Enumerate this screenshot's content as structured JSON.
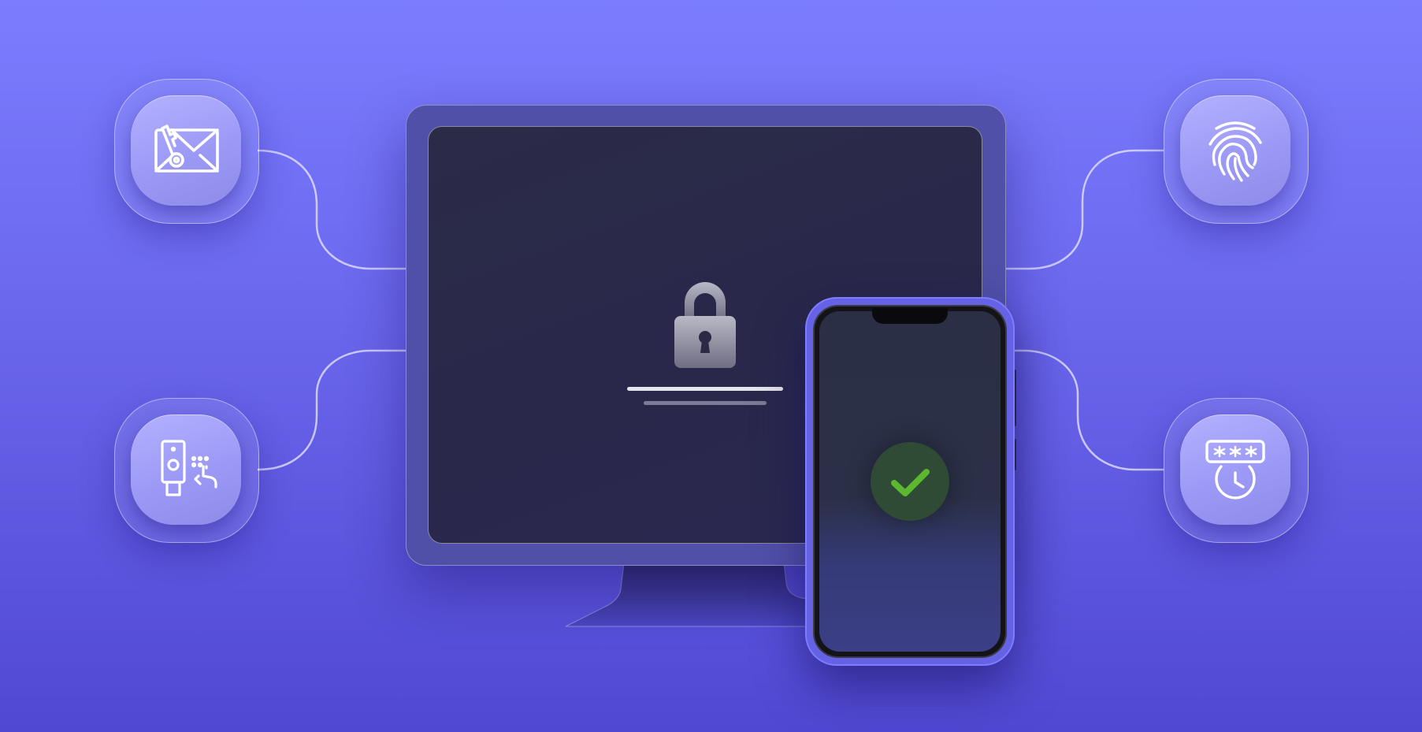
{
  "scene": {
    "colors": {
      "background_top": "#7b7dff",
      "background_bottom": "#5148d2",
      "method_tile": "#a09df8",
      "monitor_frame": "#5150a8",
      "monitor_screen": "#2a2948",
      "phone_body": "#6562e6",
      "success_badge": "#2f4a35",
      "success_check": "#5cb82e"
    },
    "methods": [
      {
        "icon": "email-key-icon",
        "side": "left"
      },
      {
        "icon": "security-key-touch-icon",
        "side": "left"
      },
      {
        "icon": "fingerprint-icon",
        "side": "right"
      },
      {
        "icon": "password-timer-icon",
        "side": "right"
      }
    ],
    "monitor": {
      "icon": "padlock-icon",
      "placeholder_lines": 2
    },
    "phone": {
      "status_icon": "checkmark-icon",
      "status": "verified"
    }
  }
}
